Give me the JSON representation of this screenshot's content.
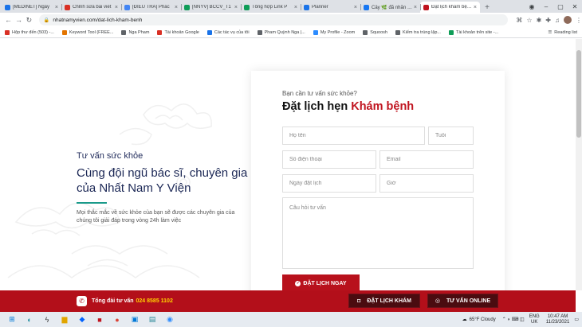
{
  "browser": {
    "tabs": [
      {
        "title": "[MEDINET] Ngày",
        "favicon_color": "#1a73e8"
      },
      {
        "title": "Chỉnh sửa bài viết",
        "favicon_color": "#d93025"
      },
      {
        "title": "[ĐIỀU TRA] Phác",
        "favicon_color": "#4285f4"
      },
      {
        "title": "[NNYV] BCCV_T1",
        "favicon_color": "#0f9d58"
      },
      {
        "title": "Tổng hợp Link P",
        "favicon_color": "#0f9d58"
      },
      {
        "title": "Planner",
        "favicon_color": "#1a73e8"
      },
      {
        "title": "Cây 🌿 đã nhắn tin",
        "favicon_color": "#1877f2"
      },
      {
        "title": "Đặt lịch khám bệnh",
        "favicon_color": "#c0141f",
        "active": true
      }
    ],
    "url": "nhatnamyvien.com/dat-lich-kham-benh",
    "bookmarks": [
      {
        "label": "Hộp thư đến (503) -...",
        "color": "#d93025"
      },
      {
        "label": "Keyword Tool (FREE...",
        "color": "#e37400"
      },
      {
        "label": "Nga Pham",
        "color": "#5f6368"
      },
      {
        "label": "Tài khoản Google",
        "color": "#d93025"
      },
      {
        "label": "Các tác vụ của tôi",
        "color": "#1a73e8"
      },
      {
        "label": "Pham Quỳnh Nga |...",
        "color": "#5f6368"
      },
      {
        "label": "My Profile - Zoom",
        "color": "#2d8cff"
      },
      {
        "label": "Squoosh",
        "color": "#5f6368"
      },
      {
        "label": "Kiểm tra trùng lặp...",
        "color": "#5f6368"
      },
      {
        "label": "Tài khoản trên site -...",
        "color": "#0f9d58"
      }
    ],
    "reading_list": "Reading list"
  },
  "hero": {
    "eyebrow": "Tư vấn sức khỏe",
    "heading": "Cùng đội ngũ bác sĩ, chuyên gia của Nhất Nam Y Viện",
    "description": "Mọi thắc mắc về sức khỏe của bạn sẽ được các chuyên gia của chúng tôi giải đáp trong vòng 24h làm việc"
  },
  "form": {
    "eyebrow": "Bạn cần tư vấn sức khỏe?",
    "title_prefix": "Đặt lịch hẹn ",
    "title_highlight": "Khám bệnh",
    "placeholders": {
      "name": "Họ tên",
      "age": "Tuổi",
      "phone": "Số điện thoại",
      "email": "Email",
      "date": "Ngày đặt lịch",
      "time": "Giờ",
      "question": "Câu hỏi tư vấn"
    },
    "submit_label": "ĐẶT LỊCH NGAY"
  },
  "bottom_bar": {
    "hotline_label": "Tổng đài tư vấn",
    "hotline_number": "024 8585 1102",
    "book_button": "ĐẶT LỊCH KHÁM",
    "online_button": "TƯ VẤN ONLINE"
  },
  "taskbar": {
    "weather": "65°F Cloudy",
    "lang_top": "ENG",
    "lang_bottom": "UK",
    "time": "10:47 AM",
    "date": "11/23/2021"
  },
  "colors": {
    "brand_red": "#b8111c",
    "navy": "#1b2755",
    "teal": "#1a9a8a",
    "hotline_yellow": "#ffd200"
  }
}
